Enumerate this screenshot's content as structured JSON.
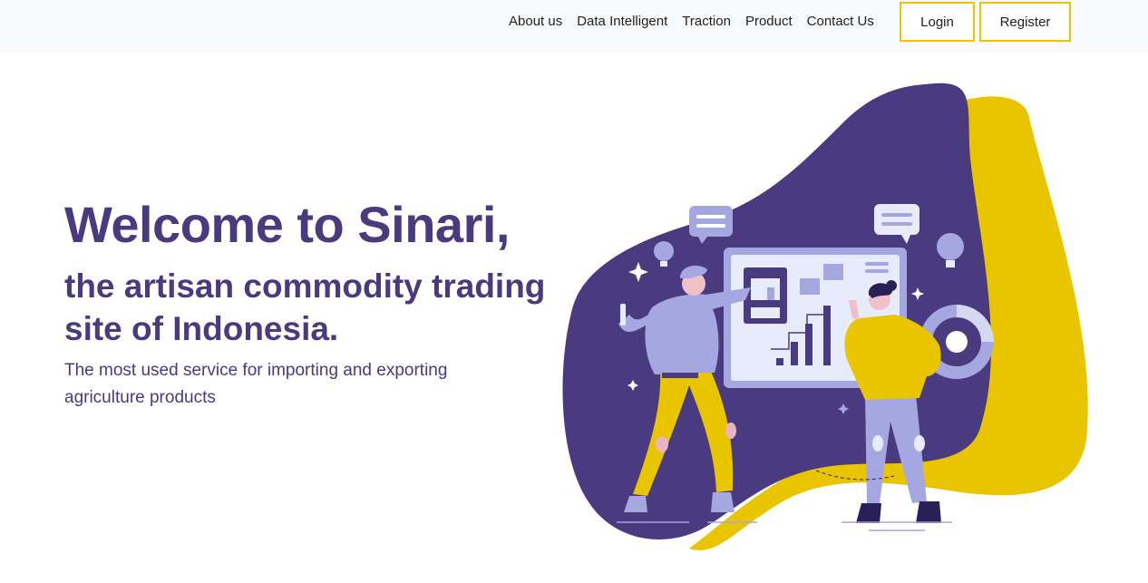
{
  "nav": {
    "links": [
      "About us",
      "Data Intelligent",
      "Traction",
      "Product",
      "Contact Us"
    ],
    "login_label": "Login",
    "register_label": "Register"
  },
  "hero": {
    "title": "Welcome to Sinari,",
    "subtitle": "the artisan commodity trading site of Indonesia.",
    "description": "The most used service for importing and exporting agriculture products"
  },
  "colors": {
    "brand_purple": "#4a3a80",
    "accent_yellow": "#e9c500",
    "lavender": "#a5a8e0"
  }
}
